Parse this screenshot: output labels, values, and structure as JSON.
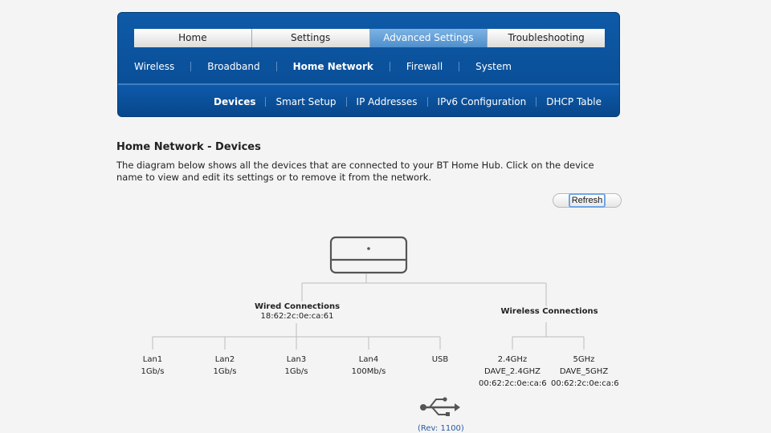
{
  "tabs": [
    {
      "label": "Home"
    },
    {
      "label": "Settings"
    },
    {
      "label": "Advanced Settings"
    },
    {
      "label": "Troubleshooting"
    }
  ],
  "subnav": [
    {
      "label": "Wireless"
    },
    {
      "label": "Broadband"
    },
    {
      "label": "Home Network"
    },
    {
      "label": "Firewall"
    },
    {
      "label": "System"
    }
  ],
  "subsub": [
    {
      "label": "Devices"
    },
    {
      "label": "Smart Setup"
    },
    {
      "label": "IP Addresses"
    },
    {
      "label": "IPv6 Configuration"
    },
    {
      "label": "DHCP Table"
    }
  ],
  "page": {
    "title": "Home Network - Devices",
    "description": "The diagram below shows all the devices that are connected to your BT Home Hub. Click on the device name to view and edit its settings or to remove it from the network.",
    "refresh_label": "Refresh"
  },
  "diagram": {
    "wired_title": "Wired Connections",
    "wired_mac": "18:62:2c:0e:ca:61",
    "wireless_title": "Wireless Connections",
    "ports": [
      {
        "name": "Lan1",
        "speed": "1Gb/s"
      },
      {
        "name": "Lan2",
        "speed": "1Gb/s"
      },
      {
        "name": "Lan3",
        "speed": "1Gb/s"
      },
      {
        "name": "Lan4",
        "speed": "100Mb/s"
      },
      {
        "name": "USB",
        "speed": ""
      }
    ],
    "wifi": [
      {
        "band": "2.4GHz",
        "ssid": "DAVE_2.4GHZ",
        "mac": "00:62:2c:0e:ca:6"
      },
      {
        "band": "5GHz",
        "ssid": "DAVE_5GHZ",
        "mac": "00:62:2c:0e:ca:6"
      }
    ],
    "rev": "(Rev: 1100)"
  },
  "icons": {
    "hub": "router-icon",
    "usb": "usb-icon"
  },
  "colors": {
    "brand_blue": "#0a4f98",
    "active_tab": "#5d9ad4",
    "link": "#2a5aa0"
  }
}
